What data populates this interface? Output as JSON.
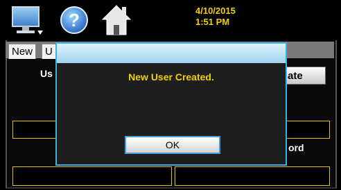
{
  "topbar": {
    "date": "4/10/2015",
    "time": "1:51 PM",
    "icons": [
      "monitor-icon",
      "help-icon",
      "home-icon"
    ]
  },
  "tabs": [
    {
      "label": "New"
    },
    {
      "label": "U"
    }
  ],
  "background": {
    "user_label_partial": "Us",
    "action_button_partial": "ate",
    "password_label_partial": "ord"
  },
  "dialog": {
    "message": "New User Created.",
    "ok_label": "OK"
  },
  "colors": {
    "accent_yellow": "#f0d000",
    "dialog_border": "#3fb0e0",
    "field_border": "#e0c000"
  }
}
